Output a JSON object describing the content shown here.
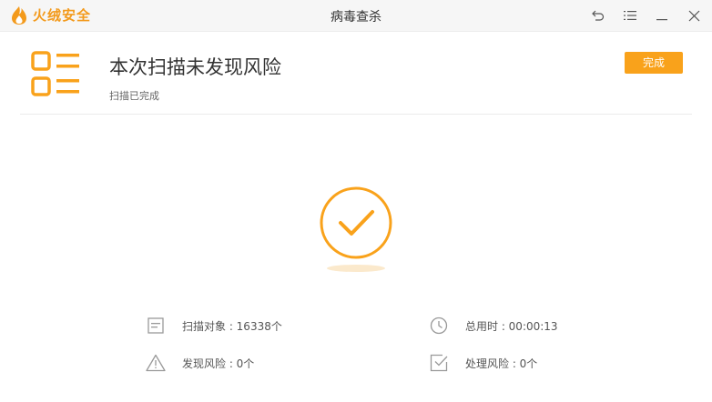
{
  "app": {
    "brand": "火绒安全",
    "window_title": "病毒查杀",
    "accent_color": "#f9a21b"
  },
  "window_controls": [
    {
      "name": "back-icon"
    },
    {
      "name": "menu-icon"
    },
    {
      "name": "minimize-icon"
    },
    {
      "name": "close-icon"
    }
  ],
  "result": {
    "title": "本次扫描未发现风险",
    "subtitle": "扫描已完成",
    "done_label": "完成",
    "status_icon": "check-circle-icon"
  },
  "stats": {
    "objects": "扫描对象 : 16338个",
    "time": "总用时 : 00:00:13",
    "risks": "发现风险 : 0个",
    "handled": "处理风险 : 0个"
  }
}
